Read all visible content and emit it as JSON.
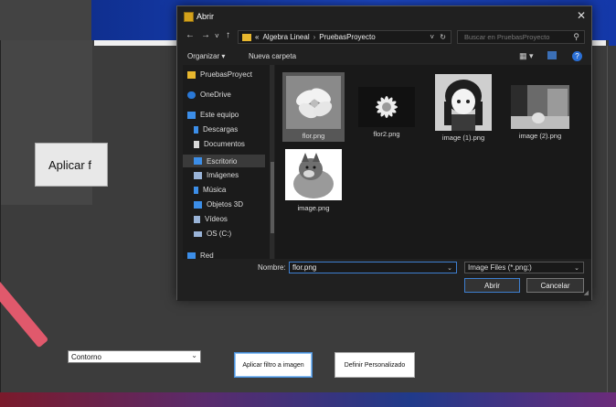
{
  "dialog": {
    "title": "Abrir",
    "close_glyph": "✕",
    "nav": {
      "back": "←",
      "forward": "→",
      "recent": "˅",
      "up": "↑"
    },
    "breadcrumb": {
      "overflow": "«",
      "folder1": "Algebra Lineal",
      "separator": "›",
      "folder2": "PruebasProyecto",
      "dropdown": "˅",
      "refresh": "↻"
    },
    "search_placeholder": "Buscar en PruebasProyecto",
    "toolbar": {
      "organize": "Organizar ▾",
      "new_folder": "Nueva carpeta",
      "view": "▦ ▾",
      "help": "?"
    },
    "sidebar": [
      {
        "label": "PruebasProyect",
        "icon": "folder-icon",
        "color": "#e8b72e"
      },
      {
        "label": "OneDrive",
        "icon": "cloud-icon",
        "color": "#2a78d6"
      },
      {
        "label": "Este equipo",
        "icon": "computer-icon",
        "color": "#3c8ee8"
      },
      {
        "label": "Descargas",
        "icon": "download-icon",
        "color": "#3c8ee8"
      },
      {
        "label": "Documentos",
        "icon": "document-icon",
        "color": "#d9d9d9"
      },
      {
        "label": "Escritorio",
        "icon": "desktop-icon",
        "color": "#3c8ee8"
      },
      {
        "label": "Imágenes",
        "icon": "image-icon",
        "color": "#9ab4d8"
      },
      {
        "label": "Música",
        "icon": "music-icon",
        "color": "#3c8ee8"
      },
      {
        "label": "Objetos 3D",
        "icon": "cube-icon",
        "color": "#3c8ee8"
      },
      {
        "label": "Vídeos",
        "icon": "video-icon",
        "color": "#9ab4d8"
      },
      {
        "label": "OS (C:)",
        "icon": "drive-icon",
        "color": "#9ab4d8"
      },
      {
        "label": "Red",
        "icon": "network-icon",
        "color": "#3c8ee8"
      }
    ],
    "files": [
      {
        "name": "flor.png"
      },
      {
        "name": "flor2.png"
      },
      {
        "name": "image (1).png"
      },
      {
        "name": "image (2).png"
      },
      {
        "name": "image.png"
      }
    ],
    "filename_label": "Nombre:",
    "filename_value": "flor.png",
    "filetype": "Image Files  (*.png;)",
    "open_button": "Abrir",
    "cancel_button": "Cancelar"
  },
  "app": {
    "apply_left_label": "Aplicar f",
    "filter_select_value": "Contorno",
    "apply_filter_button": "Aplicar filtro a imagen",
    "custom_button": "Definir Personalizado"
  },
  "colors": {
    "accent": "#3e7fd0",
    "stroke": "#e0596c",
    "desktop": "#1d49c9"
  }
}
